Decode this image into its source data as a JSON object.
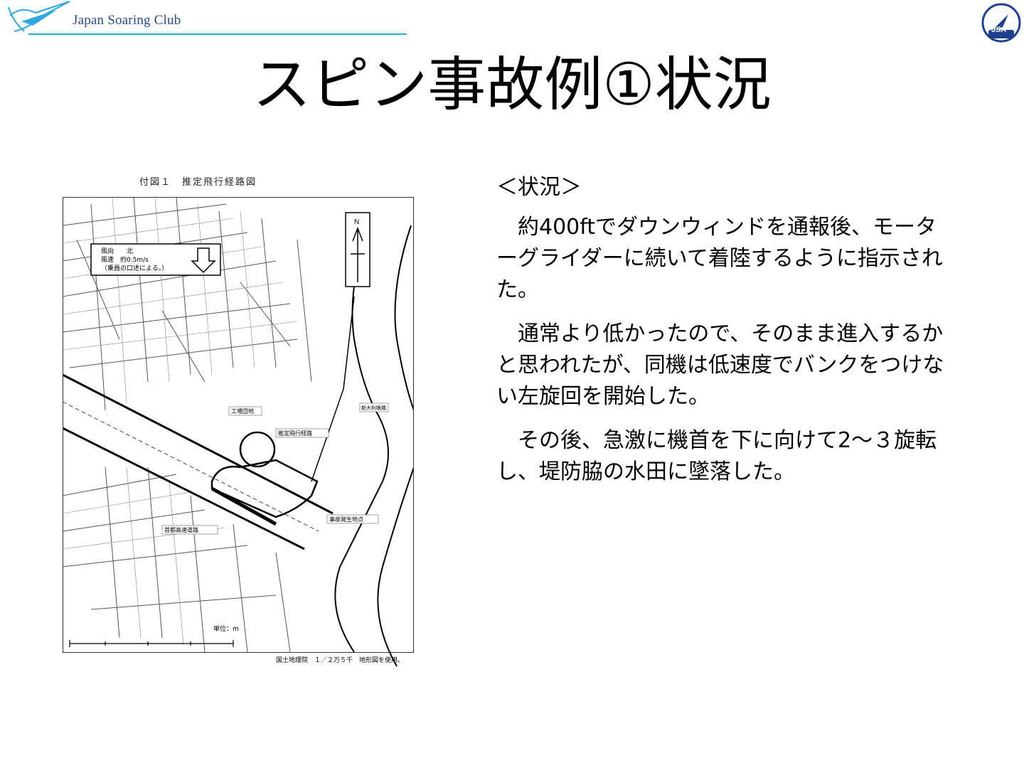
{
  "header": {
    "brand": "Japan Soaring Club",
    "emblem_text": "JSA"
  },
  "slide": {
    "title": "スピン事故例①状況"
  },
  "figure": {
    "caption": "付図１　推定飛行経路図",
    "wind_note_line1": "風向　　北",
    "wind_note_line2": "風速　約0.5m/s",
    "wind_note_line3": "（乗員の口述による。）",
    "north_label": "N",
    "label_route": "推定飛行経路",
    "label_building": "工場団地",
    "label_bridge": "新大利根橋",
    "label_site": "事故発生地点",
    "label_highway": "首都高速道路",
    "label_scale": "単位：m",
    "source_note": "国土地理院　１／２万５千　地形図を使用。"
  },
  "content": {
    "heading": "＜状況＞",
    "paragraphs": [
      "　約400ftでダウンウィンドを通報後、モーターグライダーに続いて着陸するように指示された。",
      "　通常より低かったので、そのまま進入するかと思われたが、同機は低速度でバンクをつけない左旋回を開始した。",
      "　その後、急激に機首を下に向けて2～３旋転し、堤防脇の水田に墜落した。"
    ]
  },
  "colors": {
    "accent_line": "#2fa8e0",
    "brand_text": "#2a4a8a",
    "emblem_blue": "#1f3f8f"
  }
}
